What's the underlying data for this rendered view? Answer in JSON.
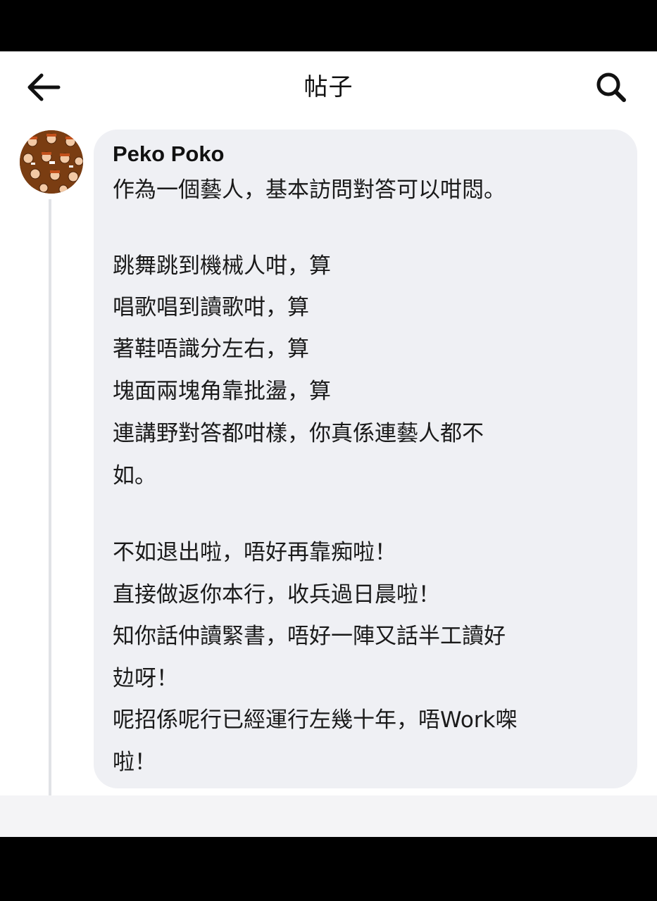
{
  "header": {
    "title": "帖子",
    "back_icon": "arrow-left-icon",
    "search_icon": "search-icon"
  },
  "post": {
    "author": "Peko Poko",
    "avatar_icon": "avatar-pattern",
    "lines": [
      "作為一個藝人，基本訪問對答可以咁悶。",
      "跳舞跳到機械人咁，算",
      "唱歌唱到讀歌咁，算",
      "著鞋唔識分左右，算",
      "塊面兩塊角靠批盪，算",
      "連講野對答都咁樣，你真係連藝人都不",
      "如。",
      "不如退出啦，唔好再靠痴啦！",
      "直接做返你本行，收兵過日晨啦！",
      "知你話仲讀緊書，唔好一陣又話半工讀好",
      "攰呀！",
      "呢招係呢行已經運行左幾十年，唔Work㗎",
      "啦！"
    ]
  },
  "colors": {
    "bubble": "#eff0f4",
    "thread_line": "#e1e2e6",
    "avatar_bg": "#7a3d12",
    "text": "#1a1a1a"
  }
}
